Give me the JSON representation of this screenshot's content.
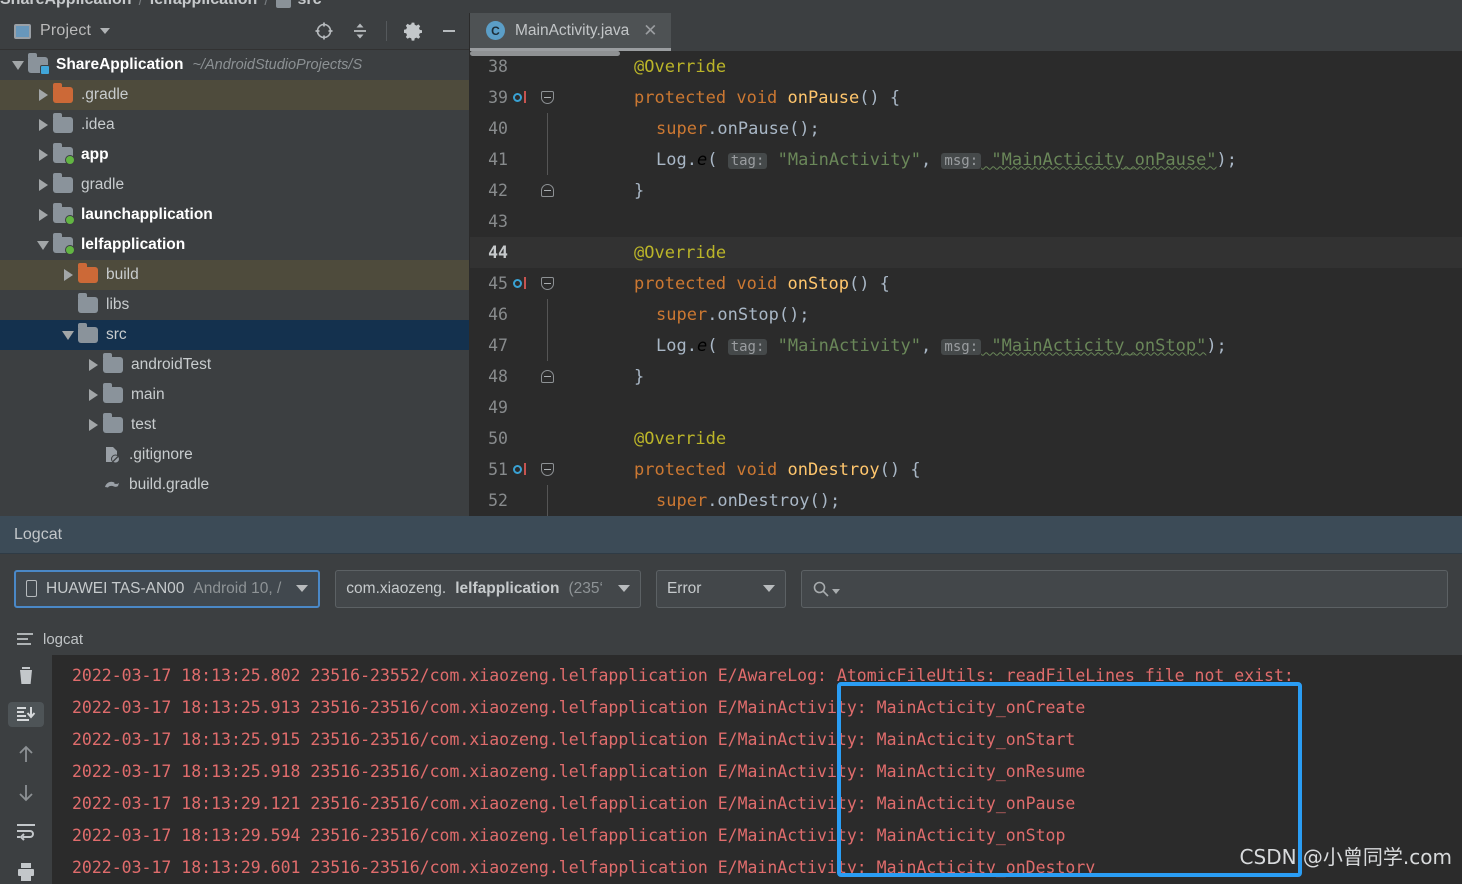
{
  "breadcrumb": {
    "items": [
      "ShareApplication",
      "lelfapplication",
      "src"
    ],
    "separator": "/"
  },
  "project_panel": {
    "title": "Project",
    "caret_icon": "chevron-down-icon",
    "toolbar": [
      {
        "name": "locate-target-icon",
        "glyph": "target"
      },
      {
        "name": "collapse-all-icon",
        "glyph": "collapse"
      },
      {
        "name": "settings-gear-icon",
        "glyph": "gear"
      },
      {
        "name": "hide-panel-icon",
        "glyph": "minus"
      }
    ],
    "tree": [
      {
        "label": "ShareApplication",
        "path": "~/AndroidStudioProjects/S",
        "indent": 0,
        "arrow": "open",
        "icon": "module-folder",
        "bold": true,
        "state": "none"
      },
      {
        "label": ".gradle",
        "indent": 1,
        "arrow": "closed",
        "icon": "folder-orange",
        "state": "highlight"
      },
      {
        "label": ".idea",
        "indent": 1,
        "arrow": "closed",
        "icon": "folder",
        "state": "none"
      },
      {
        "label": "app",
        "indent": 1,
        "arrow": "closed",
        "icon": "module-folder",
        "bold": true,
        "state": "none"
      },
      {
        "label": "gradle",
        "indent": 1,
        "arrow": "closed",
        "icon": "folder",
        "state": "none"
      },
      {
        "label": "launchapplication",
        "indent": 1,
        "arrow": "closed",
        "icon": "module-folder",
        "bold": true,
        "state": "none"
      },
      {
        "label": "lelfapplication",
        "indent": 1,
        "arrow": "open",
        "icon": "module-folder",
        "bold": true,
        "state": "none"
      },
      {
        "label": "build",
        "indent": 2,
        "arrow": "closed",
        "icon": "folder-orange",
        "state": "highlight"
      },
      {
        "label": "libs",
        "indent": 2,
        "arrow": "none",
        "icon": "folder",
        "state": "none"
      },
      {
        "label": "src",
        "indent": 2,
        "arrow": "open",
        "icon": "folder",
        "state": "selected"
      },
      {
        "label": "androidTest",
        "indent": 3,
        "arrow": "closed",
        "icon": "folder",
        "state": "none"
      },
      {
        "label": "main",
        "indent": 3,
        "arrow": "closed",
        "icon": "folder",
        "state": "none"
      },
      {
        "label": "test",
        "indent": 3,
        "arrow": "closed",
        "icon": "folder",
        "state": "none"
      },
      {
        "label": ".gitignore",
        "indent": 3,
        "arrow": "none",
        "icon": "gitignore-file",
        "state": "none"
      },
      {
        "label": "build.gradle",
        "indent": 3,
        "arrow": "none",
        "icon": "gradle-file",
        "state": "none"
      }
    ]
  },
  "editor": {
    "tab": {
      "label": "MainActivity.java",
      "badge": "C",
      "close_icon": "close-icon"
    },
    "lines": [
      {
        "no": "38",
        "gutter": "none",
        "fold": "none",
        "indent": 3,
        "current": false,
        "tokens": [
          {
            "t": "anno",
            "v": "@Override"
          }
        ]
      },
      {
        "no": "39",
        "gutter": "override",
        "fold": "down",
        "indent": 3,
        "current": false,
        "tokens": [
          {
            "t": "kw",
            "v": "protected void "
          },
          {
            "t": "mname",
            "v": "onPause"
          },
          {
            "t": "plain",
            "v": "() {"
          }
        ]
      },
      {
        "no": "40",
        "gutter": "none",
        "fold": "line",
        "indent": 4,
        "current": false,
        "tokens": [
          {
            "t": "kw",
            "v": "super"
          },
          {
            "t": "plain",
            "v": ".onPause();"
          }
        ]
      },
      {
        "no": "41",
        "gutter": "none",
        "fold": "line",
        "indent": 4,
        "current": false,
        "tokens": [
          {
            "t": "plain",
            "v": "Log."
          },
          {
            "t": "ital",
            "v": "e"
          },
          {
            "t": "plain",
            "v": "( "
          },
          {
            "t": "hint",
            "v": "tag:"
          },
          {
            "t": "str",
            "v": " \"MainActivity\""
          },
          {
            "t": "plain",
            "v": ", "
          },
          {
            "t": "hint",
            "v": "msg:"
          },
          {
            "t": "strsquig",
            "v": " \"MainActicity_onPause\""
          },
          {
            "t": "plain",
            "v": ");"
          }
        ]
      },
      {
        "no": "42",
        "gutter": "none",
        "fold": "up",
        "indent": 3,
        "current": false,
        "tokens": [
          {
            "t": "plain",
            "v": "}"
          }
        ]
      },
      {
        "no": "43",
        "gutter": "none",
        "fold": "none",
        "indent": 0,
        "current": false,
        "tokens": []
      },
      {
        "no": "44",
        "gutter": "none",
        "fold": "none",
        "indent": 3,
        "current": true,
        "tokens": [
          {
            "t": "anno",
            "v": "@Override"
          }
        ]
      },
      {
        "no": "45",
        "gutter": "override",
        "fold": "down",
        "indent": 3,
        "current": false,
        "tokens": [
          {
            "t": "kw",
            "v": "protected void "
          },
          {
            "t": "mname",
            "v": "onStop"
          },
          {
            "t": "plain",
            "v": "() {"
          }
        ]
      },
      {
        "no": "46",
        "gutter": "none",
        "fold": "line",
        "indent": 4,
        "current": false,
        "tokens": [
          {
            "t": "kw",
            "v": "super"
          },
          {
            "t": "plain",
            "v": ".onStop();"
          }
        ]
      },
      {
        "no": "47",
        "gutter": "none",
        "fold": "line",
        "indent": 4,
        "current": false,
        "tokens": [
          {
            "t": "plain",
            "v": "Log."
          },
          {
            "t": "ital",
            "v": "e"
          },
          {
            "t": "plain",
            "v": "( "
          },
          {
            "t": "hint",
            "v": "tag:"
          },
          {
            "t": "str",
            "v": " \"MainActivity\""
          },
          {
            "t": "plain",
            "v": ", "
          },
          {
            "t": "hint",
            "v": "msg:"
          },
          {
            "t": "strsquig",
            "v": " \"MainActicity_onStop\""
          },
          {
            "t": "plain",
            "v": ");"
          }
        ]
      },
      {
        "no": "48",
        "gutter": "none",
        "fold": "up",
        "indent": 3,
        "current": false,
        "tokens": [
          {
            "t": "plain",
            "v": "}"
          }
        ]
      },
      {
        "no": "49",
        "gutter": "none",
        "fold": "none",
        "indent": 0,
        "current": false,
        "tokens": []
      },
      {
        "no": "50",
        "gutter": "none",
        "fold": "none",
        "indent": 3,
        "current": false,
        "tokens": [
          {
            "t": "anno",
            "v": "@Override"
          }
        ]
      },
      {
        "no": "51",
        "gutter": "override",
        "fold": "down",
        "indent": 3,
        "current": false,
        "tokens": [
          {
            "t": "kw",
            "v": "protected void "
          },
          {
            "t": "mname",
            "v": "onDestroy"
          },
          {
            "t": "plain",
            "v": "() {"
          }
        ]
      },
      {
        "no": "52",
        "gutter": "none",
        "fold": "line",
        "indent": 4,
        "current": false,
        "tokens": [
          {
            "t": "kw",
            "v": "super"
          },
          {
            "t": "plain",
            "v": ".onDestroy();"
          }
        ]
      }
    ]
  },
  "logcat": {
    "title": "Logcat",
    "device": {
      "name": "HUAWEI TAS-AN00",
      "detail": "Android 10, /",
      "icon": "phone-icon"
    },
    "process": {
      "prefix": "com.xiaozeng.",
      "bold": "lelfapplication",
      "suffix": " (235‘"
    },
    "level": "Error",
    "search_placeholder": "",
    "search_icon": "search-icon",
    "tab_label": "logcat",
    "sidebar_buttons": [
      {
        "name": "clear-logcat-icon",
        "glyph": "trash",
        "active": false
      },
      {
        "name": "scroll-to-end-icon",
        "glyph": "scroll-end",
        "active": true
      },
      {
        "name": "previous-occurrence-icon",
        "glyph": "arrow-up",
        "active": false
      },
      {
        "name": "next-occurrence-icon",
        "glyph": "arrow-down",
        "active": false
      },
      {
        "name": "soft-wrap-icon",
        "glyph": "wrap",
        "active": false
      },
      {
        "name": "print-icon",
        "glyph": "print",
        "active": false
      }
    ],
    "lines": [
      {
        "prefix": "2022-03-17 18:13:25.802 23516-23552/com.xiaozeng.lelfapplication",
        "msg": " E/AwareLog: AtomicFileUtils: readFileLines file not exist:",
        "highlighted": false
      },
      {
        "prefix": "2022-03-17 18:13:25.913 23516-23516/com.xiaozeng.lelfapplication",
        "msg": " E/MainActivity: MainActicity_onCreate",
        "highlighted": true
      },
      {
        "prefix": "2022-03-17 18:13:25.915 23516-23516/com.xiaozeng.lelfapplication",
        "msg": " E/MainActivity: MainActicity_onStart",
        "highlighted": true
      },
      {
        "prefix": "2022-03-17 18:13:25.918 23516-23516/com.xiaozeng.lelfapplication",
        "msg": " E/MainActivity: MainActicity_onResume",
        "highlighted": true
      },
      {
        "prefix": "2022-03-17 18:13:29.121 23516-23516/com.xiaozeng.lelfapplication",
        "msg": " E/MainActivity: MainActicity_onPause",
        "highlighted": true
      },
      {
        "prefix": "2022-03-17 18:13:29.594 23516-23516/com.xiaozeng.lelfapplication",
        "msg": " E/MainActivity: MainActicity_onStop",
        "highlighted": true
      },
      {
        "prefix": "2022-03-17 18:13:29.601 23516-23516/com.xiaozeng.lelfapplication",
        "msg": " E/MainActivity: MainActicity_onDestory",
        "highlighted": true
      }
    ],
    "highlight_color": "#2a9df4"
  },
  "watermark": "CSDN @小曾同学.com",
  "colors": {
    "panel_bg": "#3c3f41",
    "editor_bg": "#2b2b2b",
    "selection_blue": "#14314e",
    "highlight_khaki": "#4e4b3c",
    "log_red": "#e06c6c",
    "accent_blue": "#2a9df4"
  }
}
